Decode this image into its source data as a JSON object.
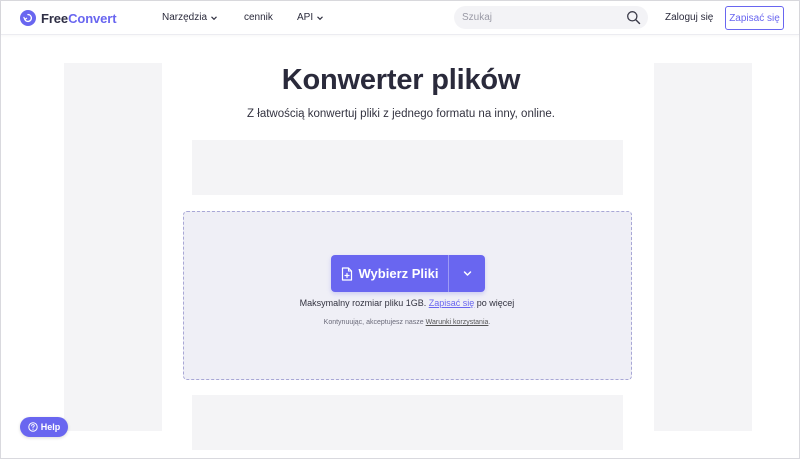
{
  "header": {
    "logo": {
      "part1": "Free",
      "part2": "Convert"
    },
    "nav": {
      "tools": "Narzędzia",
      "pricing": "cennik",
      "api": "API"
    },
    "search": {
      "placeholder": "Szukaj"
    },
    "login": "Zaloguj się",
    "signup": "Zapisać się"
  },
  "hero": {
    "title": "Konwerter plików",
    "subtitle": "Z łatwością konwertuj pliki z jednego formatu na inny, online."
  },
  "upload": {
    "choose_label": "Wybierz Pliki",
    "limit_prefix": "Maksymalny rozmiar pliku 1GB.",
    "limit_link": "Zapisać się",
    "limit_suffix": "po więcej",
    "terms_prefix": "Kontynuując, akceptujesz nasze",
    "terms_link": "Warunki korzystania",
    "terms_suffix": "."
  },
  "help": {
    "label": "Help"
  },
  "colors": {
    "accent": "#6966f0",
    "dropzone_bg": "#efeff6",
    "ad_placeholder": "#f4f4f6"
  },
  "icons": [
    "logo-icon",
    "chevron-down-icon",
    "search-icon",
    "file-plus-icon",
    "help-icon"
  ]
}
